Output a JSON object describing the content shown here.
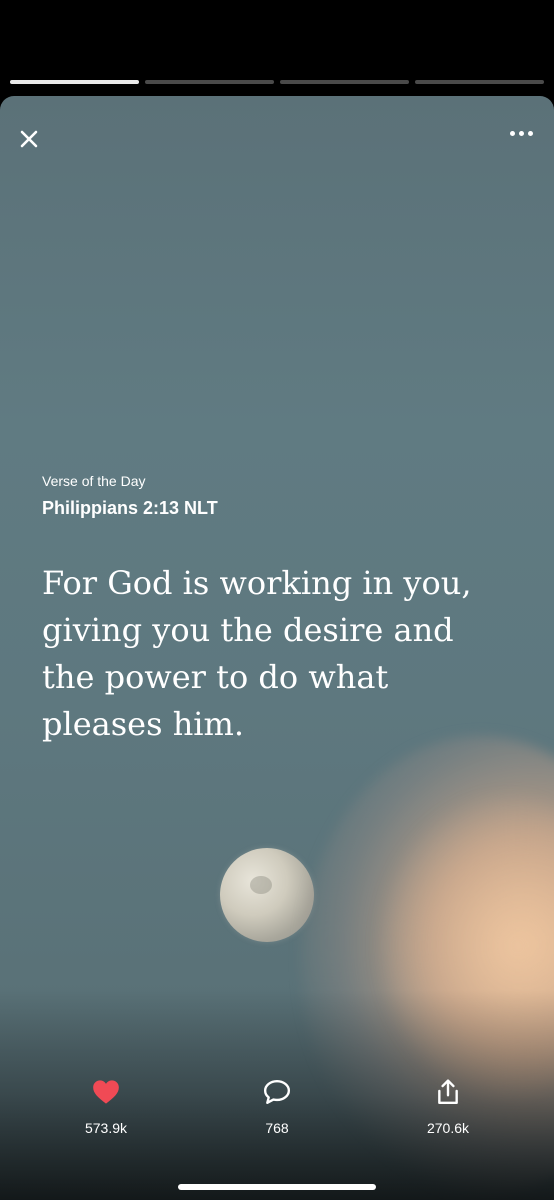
{
  "story": {
    "segments": 4,
    "active_segment": 1
  },
  "header": {
    "close_icon": "close-icon",
    "more_icon": "more-options-icon"
  },
  "verse": {
    "label": "Verse of the Day",
    "reference": "Philippians 2:13 NLT",
    "lines": [
      "For God is working in you,",
      "giving you the desire and",
      "the power to do what",
      "pleases him."
    ]
  },
  "actions": {
    "like": {
      "icon": "heart-icon",
      "count": "573.9k",
      "color": "#f04a55"
    },
    "comment": {
      "icon": "comment-icon",
      "count": "768"
    },
    "share": {
      "icon": "share-icon",
      "count": "270.6k"
    }
  }
}
